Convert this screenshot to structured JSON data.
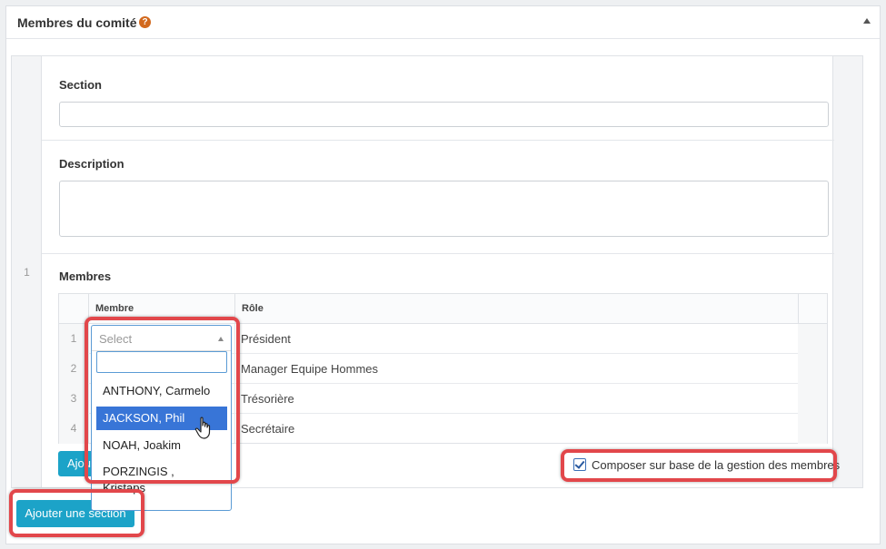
{
  "panel": {
    "title": "Membres du comité",
    "help_glyph": "?"
  },
  "section": {
    "index": "1",
    "section_label": "Section",
    "section_value": "",
    "description_label": "Description",
    "description_value": "",
    "members_label": "Membres"
  },
  "table": {
    "col_member": "Membre",
    "col_role": "Rôle",
    "rows": [
      {
        "index": "1",
        "role": "Président"
      },
      {
        "index": "2",
        "role": "Manager Equipe Hommes"
      },
      {
        "index": "3",
        "role": "Trésorière"
      },
      {
        "index": "4",
        "role": "Secrétaire"
      }
    ]
  },
  "dropdown": {
    "placeholder": "Select",
    "search_value": "",
    "options": [
      {
        "label": "ANTHONY, Carmelo",
        "selected": false
      },
      {
        "label": "JACKSON, Phil",
        "selected": true
      },
      {
        "label": "NOAH, Joakim",
        "selected": false
      },
      {
        "label": "PORZINGIS , Kristaps",
        "selected": false
      }
    ]
  },
  "buttons": {
    "add_row": "Ajouter",
    "add_section": "Ajouter une section"
  },
  "compose": {
    "label": "Composer sur base de la gestion des membres",
    "checked": true
  },
  "colors": {
    "accent": "#1ca3c8",
    "highlight": "#e2474b",
    "selection": "#3875d7"
  }
}
